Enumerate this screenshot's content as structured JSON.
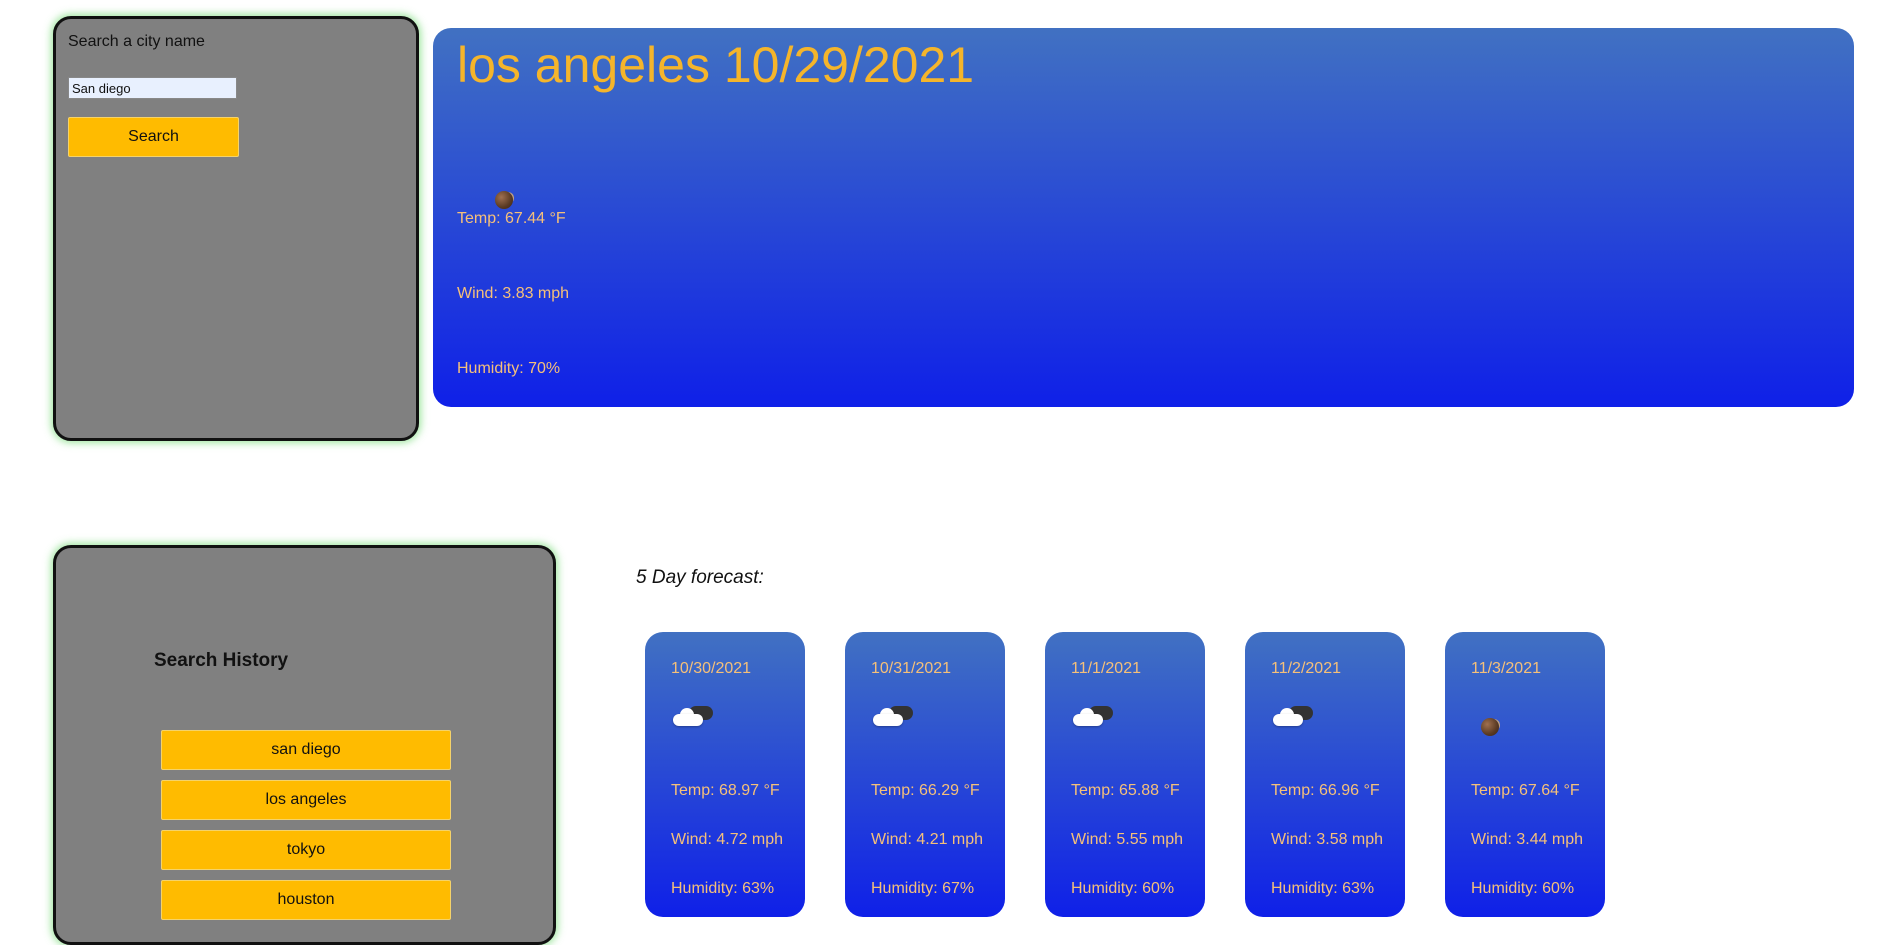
{
  "search": {
    "label": "Search a city name",
    "input_value": "San diego",
    "button_label": "Search"
  },
  "current": {
    "title": "los angeles 10/29/2021",
    "icon": "moon-icon",
    "temp": "Temp: 67.44 °F",
    "wind": "Wind: 3.83 mph",
    "humidity": "Humidity: 70%"
  },
  "history": {
    "title": "Search History",
    "items": [
      "san diego",
      "los angeles",
      "tokyo",
      "houston"
    ]
  },
  "forecast": {
    "heading": "5 Day forecast:",
    "days": [
      {
        "date": "10/30/2021",
        "icon": "cloud-icon",
        "temp": "Temp: 68.97 °F",
        "wind": "Wind: 4.72 mph",
        "humidity": "Humidity: 63%"
      },
      {
        "date": "10/31/2021",
        "icon": "cloud-icon",
        "temp": "Temp: 66.29 °F",
        "wind": "Wind: 4.21 mph",
        "humidity": "Humidity: 67%"
      },
      {
        "date": "11/1/2021",
        "icon": "cloud-icon",
        "temp": "Temp: 65.88 °F",
        "wind": "Wind: 5.55 mph",
        "humidity": "Humidity: 60%"
      },
      {
        "date": "11/2/2021",
        "icon": "cloud-icon",
        "temp": "Temp: 66.96 °F",
        "wind": "Wind: 3.58 mph",
        "humidity": "Humidity: 63%"
      },
      {
        "date": "11/3/2021",
        "icon": "moon-icon",
        "temp": "Temp: 67.64 °F",
        "wind": "Wind: 3.44 mph",
        "humidity": "Humidity: 60%"
      }
    ]
  },
  "colors": {
    "accent": "#ffbb00",
    "card_top": "#4171c2",
    "card_bottom": "#0f20e8",
    "panel": "#808080",
    "title_text": "#f5b52b"
  }
}
